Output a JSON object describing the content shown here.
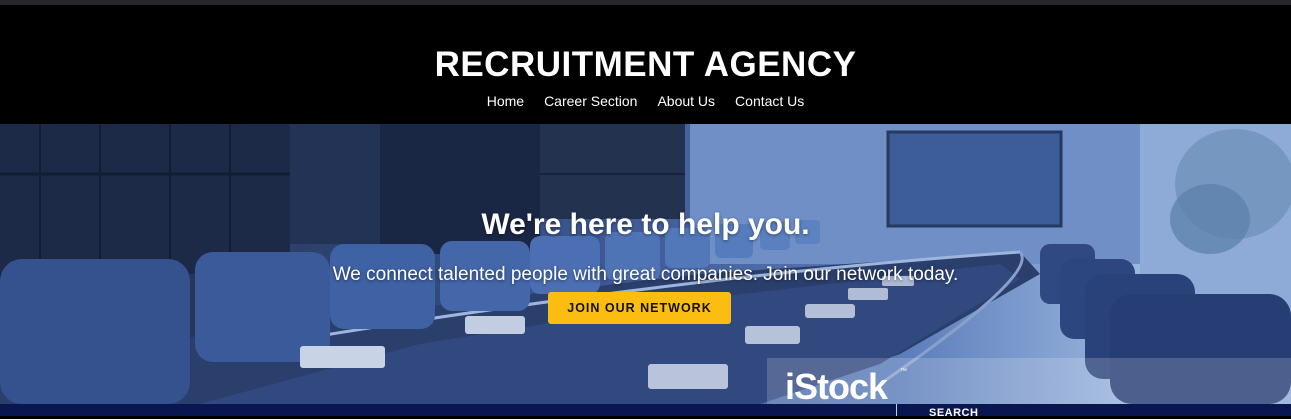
{
  "header": {
    "site_title": "RECRUITMENT AGENCY",
    "nav": [
      "Home",
      "Career Section",
      "About Us",
      "Contact Us"
    ]
  },
  "hero": {
    "title": "We're here to help you.",
    "subtitle": "We connect talented people with great companies. Join our network today.",
    "cta_label": "JOIN OUR NETWORK",
    "watermark": "iStock",
    "watermark_tm": "™"
  },
  "bottom_bar": {
    "search_label": "SEARCH"
  },
  "colors": {
    "header_bg": "#000000",
    "cta_bg": "#fbbd12",
    "bottom_bar_bg": "#0a1650"
  }
}
